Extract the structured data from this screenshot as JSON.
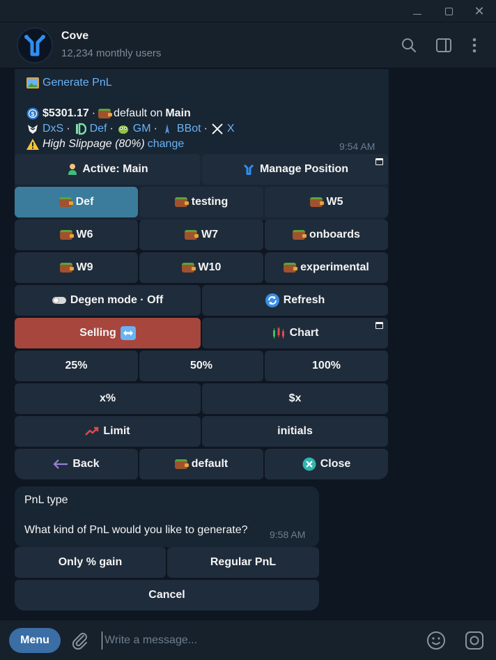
{
  "window": {
    "min": "",
    "max": "",
    "close": "✕"
  },
  "header": {
    "name": "Cove",
    "subtitle": "12,234 monthly users"
  },
  "message1": {
    "generate_pnl": "Generate PnL",
    "balance": "$5301.17",
    "sep": "·",
    "wallet_text": "default on",
    "wallet_main": "Main",
    "links": [
      "DxS",
      "Def",
      "GM",
      "BBot",
      "X"
    ],
    "warning": "High Slippage (80%)",
    "change": "change",
    "time": "9:54 AM"
  },
  "keyboard": {
    "active_main": "Active: Main",
    "manage_position": "Manage Position",
    "wallets_row1": [
      "Def",
      "testing",
      "W5"
    ],
    "wallets_row2": [
      "W6",
      "W7",
      "onboards"
    ],
    "wallets_row3": [
      "W9",
      "W10",
      "experimental"
    ],
    "degen": "Degen mode · Off",
    "refresh": "Refresh",
    "selling": "Selling",
    "chart": "Chart",
    "percents": [
      "25%",
      "50%",
      "100%"
    ],
    "x_percent": "x%",
    "x_dollar": "$x",
    "limit": "Limit",
    "initials": "initials",
    "back": "Back",
    "default": "default",
    "close": "Close"
  },
  "message2": {
    "title": "PnL type",
    "question": "What kind of PnL would you like to generate?",
    "time": "9:58 AM"
  },
  "keyboard2": {
    "only_gain": "Only % gain",
    "regular": "Regular PnL",
    "cancel": "Cancel"
  },
  "composer": {
    "menu": "Menu",
    "placeholder": "Write a message..."
  },
  "colors": {
    "background": "#0e1621",
    "bubble": "#182533",
    "button": "#1f2c3b",
    "selected": "#3b7c9c",
    "selling": "#a6463d",
    "link": "#6ab3f3",
    "menu": "#3a6ea5"
  }
}
